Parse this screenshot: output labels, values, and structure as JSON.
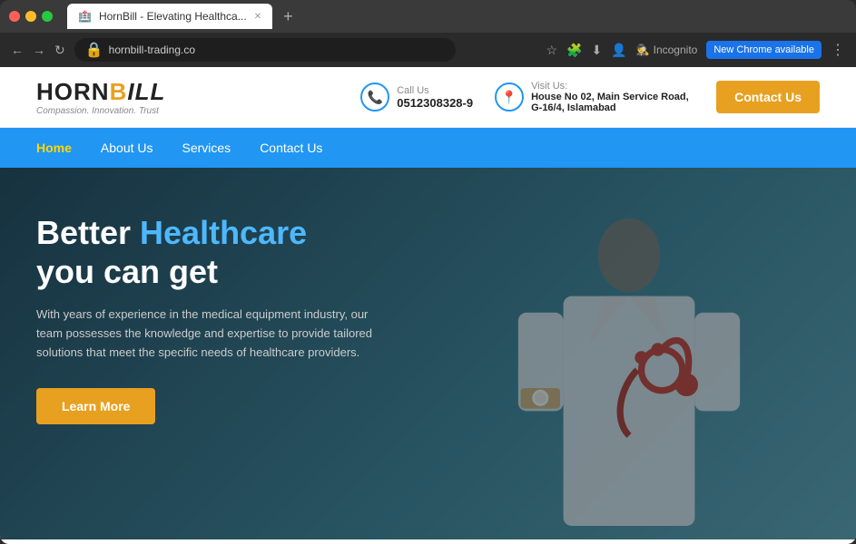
{
  "browser": {
    "tab_title": "HornBill - Elevating Healthca...",
    "url": "hornbill-trading.co",
    "new_chrome_label": "New Chrome available",
    "incognito_label": "Incognito",
    "new_tab_symbol": "+"
  },
  "header": {
    "logo_text_horn": "HORN",
    "logo_text_bill": "BILL",
    "logo_tagline": "Compassion. Innovation. Trust",
    "call_us_label": "Call Us",
    "phone_number": "0512308328-9",
    "visit_us_label": "Visit Us:",
    "address": "House No 02, Main Service Road, G-16/4, Islamabad",
    "contact_us_btn": "Contact Us"
  },
  "nav": {
    "items": [
      {
        "label": "Home",
        "active": true
      },
      {
        "label": "About Us",
        "active": false
      },
      {
        "label": "Services",
        "active": false
      },
      {
        "label": "Contact Us",
        "active": false
      }
    ]
  },
  "hero": {
    "title_plain": "Better ",
    "title_highlight": "Healthcare",
    "title_line2": "you can get",
    "description": "With years of experience in the medical equipment industry, our team possesses the knowledge and expertise to provide tailored solutions that meet the specific needs of healthcare providers.",
    "learn_more_btn": "Learn More"
  },
  "colors": {
    "accent_blue": "#2196F3",
    "accent_yellow": "#e8a020",
    "hero_highlight": "#4db8ff",
    "nav_active": "#FFD700"
  }
}
